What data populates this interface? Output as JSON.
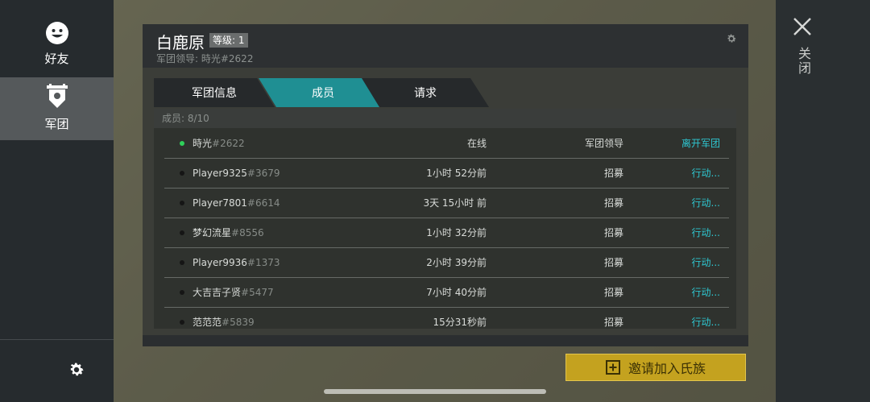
{
  "nav": {
    "friends_label": "好友",
    "clan_label": "军团"
  },
  "close": {
    "label": "关闭"
  },
  "clan": {
    "name": "白鹿原",
    "level": "等级: 1",
    "leader_line": "军团领导: 時光#2622"
  },
  "tabs": [
    "军团信息",
    "成员",
    "请求"
  ],
  "members": {
    "count": "成员: 8/10",
    "rows": [
      {
        "name": "時光",
        "tag": "#2622",
        "last": "在线",
        "role": "军团领导",
        "action": "离开军团",
        "online": true
      },
      {
        "name": "Player9325",
        "tag": "#3679",
        "last": "1小时 52分前",
        "role": "招募",
        "action": "行动...",
        "online": false
      },
      {
        "name": "Player7801",
        "tag": "#6614",
        "last": "3天 15小时 前",
        "role": "招募",
        "action": "行动...",
        "online": false
      },
      {
        "name": "梦幻流星",
        "tag": "#8556",
        "last": "1小时 32分前",
        "role": "招募",
        "action": "行动...",
        "online": false
      },
      {
        "name": "Player9936",
        "tag": "#1373",
        "last": "2小时 39分前",
        "role": "招募",
        "action": "行动...",
        "online": false
      },
      {
        "name": "大吉吉子贤",
        "tag": "#5477",
        "last": "7小时 40分前",
        "role": "招募",
        "action": "行动...",
        "online": false
      },
      {
        "name": "范范范",
        "tag": "#5839",
        "last": "15分31秒前",
        "role": "招募",
        "action": "行动...",
        "online": false
      }
    ]
  },
  "invite": {
    "label": "邀请加入氏族"
  },
  "colors": {
    "accent": "#1f8f93",
    "link": "#2ec6d0",
    "invite": "#c4a21f",
    "online": "#2fd15a"
  }
}
